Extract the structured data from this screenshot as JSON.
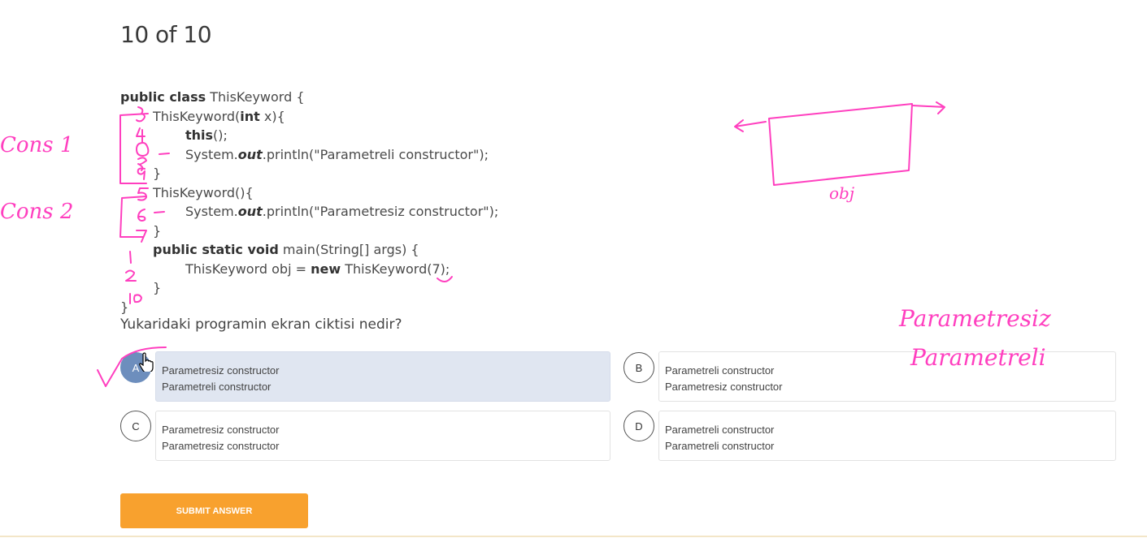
{
  "quiz": {
    "counter": "10 of 10",
    "question": "Yukaridaki programin ekran ciktisi nedir?",
    "submit_label": "SUBMIT ANSWER"
  },
  "code": {
    "l1_kw": "public class",
    "l1_rest": " ThisKeyword {",
    "l2_a": "ThisKeyword(",
    "l2_kw": "int",
    "l2_b": " x){",
    "l3_kw": "this",
    "l3_rest": "();",
    "l4_a": "System.",
    "l4_kw": "out",
    "l4_b": ".println(\"Parametreli constructor\");",
    "l5": "}",
    "l6": "ThisKeyword(){",
    "l7_a": "System.",
    "l7_kw": "out",
    "l7_b": ".println(\"Parametresiz constructor\");",
    "l8": "}",
    "l9_kw": "public static void",
    "l9_rest": " main(String[] args) {",
    "l10_a": "ThisKeyword obj = ",
    "l10_kw": "new",
    "l10_b": " ThisKeyword(7);",
    "l11": "}",
    "l12": "}"
  },
  "options": [
    {
      "letter": "A",
      "line1": "Parametresiz constructor",
      "line2": "Parametreli constructor",
      "selected": true
    },
    {
      "letter": "B",
      "line1": "Parametreli constructor",
      "line2": "Parametresiz constructor",
      "selected": false
    },
    {
      "letter": "C",
      "line1": "Parametresiz constructor",
      "line2": "Parametresiz constructor",
      "selected": false
    },
    {
      "letter": "D",
      "line1": "Parametreli constructor",
      "line2": "Parametreli constructor",
      "selected": false
    }
  ],
  "annotations": {
    "cons1": "Cons 1",
    "cons2": "Cons 2",
    "obj": "obj",
    "parametresiz": "Parametresiz",
    "parametreli": "Parametreli",
    "ink_color": "#ff3fbf"
  },
  "colors": {
    "accent": "#f8a12e",
    "selected_bg": "#e0e6f1",
    "selected_letter": "#6d8ebd"
  }
}
